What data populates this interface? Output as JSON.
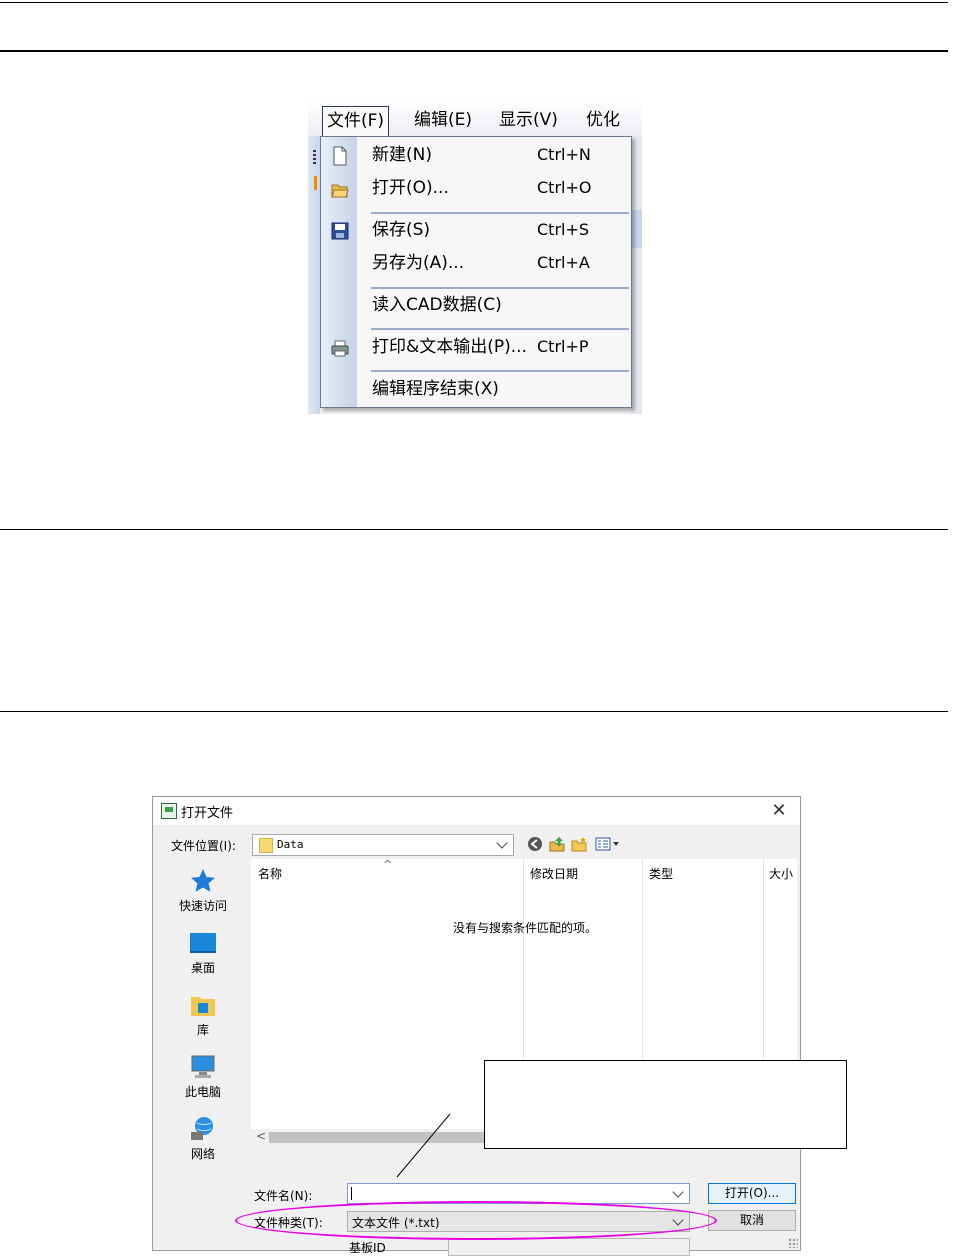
{
  "menu_window": {
    "menubar": [
      "文件(F)",
      "编辑(E)",
      "显示(V)",
      "优化(O)"
    ],
    "items": [
      {
        "label": "新建(N)",
        "shortcut": "Ctrl+N",
        "icon": "new-document-icon"
      },
      {
        "label": "打开(O)...",
        "shortcut": "Ctrl+O",
        "icon": "open-folder-icon"
      },
      {
        "label": "保存(S)",
        "shortcut": "Ctrl+S",
        "icon": "save-disk-icon"
      },
      {
        "label": "另存为(A)...",
        "shortcut": "Ctrl+A",
        "icon": ""
      },
      {
        "label": "读入CAD数据(C)",
        "shortcut": "",
        "icon": ""
      },
      {
        "label": "打印&文本输出(P)...",
        "shortcut": "Ctrl+P",
        "icon": "printer-icon"
      },
      {
        "label": "编辑程序结束(X)",
        "shortcut": "",
        "icon": ""
      }
    ]
  },
  "dialog": {
    "title": "打开文件",
    "look_in_label": "文件位置(I):",
    "look_in_value": "Data",
    "places": [
      "快速访问",
      "桌面",
      "库",
      "此电脑",
      "网络"
    ],
    "columns": [
      "名称",
      "修改日期",
      "类型",
      "大小"
    ],
    "empty_message": "没有与搜索条件匹配的项。",
    "file_name_label": "文件名(N):",
    "file_name_value": "",
    "file_type_label": "文件种类(T):",
    "file_type_value": "文本文件 (*.txt)",
    "open_button": "打开(O)...",
    "cancel_button": "取消",
    "board_id_label": "基板ID",
    "board_id_value": "",
    "colors": {
      "highlight_ellipse": "#e600e6",
      "accent": "#0078d7"
    }
  }
}
